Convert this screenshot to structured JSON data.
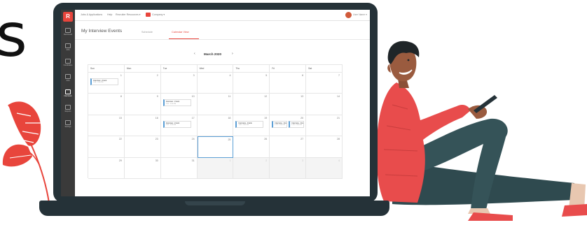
{
  "headline_letter": "s",
  "app": {
    "logo": "R",
    "sidebar": [
      {
        "label": "Dashboard",
        "icon": "dashboard-icon",
        "active": false
      },
      {
        "label": "Jobs",
        "icon": "briefcase-icon",
        "active": false
      },
      {
        "label": "Candidates",
        "icon": "candidates-icon",
        "active": false
      },
      {
        "label": "Jobs",
        "icon": "list-icon",
        "active": false
      },
      {
        "label": "Interviews",
        "icon": "interviews-icon",
        "active": true
      },
      {
        "label": "Reports",
        "icon": "reports-icon",
        "active": false
      },
      {
        "label": "Settings",
        "icon": "settings-icon",
        "active": false
      }
    ],
    "topbar": {
      "items": [
        "Jobs & Applications",
        "Help",
        "Recruiter Resources ▾",
        "Company ▾"
      ],
      "user": "User Name ▾"
    },
    "page_title": "My Interview Events",
    "tabs": [
      {
        "label": "Schedule",
        "active": false
      },
      {
        "label": "Calendar View",
        "active": true
      }
    ],
    "calendar": {
      "month": "March 2020",
      "prev": "‹",
      "next": "›",
      "weekdays": [
        "Sun",
        "Mon",
        "Tue",
        "Wed",
        "Thu",
        "Fri",
        "Sat"
      ],
      "weeks": [
        [
          {
            "day": "1",
            "event": {
              "title": "Interview - Frank",
              "time": "1:00 - 2:00 PM"
            }
          },
          {
            "day": "2"
          },
          {
            "day": "3"
          },
          {
            "day": "4"
          },
          {
            "day": "5"
          },
          {
            "day": "6"
          },
          {
            "day": "7"
          }
        ],
        [
          {
            "day": "8"
          },
          {
            "day": "9"
          },
          {
            "day": "10",
            "event": {
              "title": "Interview - Frank",
              "time": "1:00 - 2:00 PM"
            }
          },
          {
            "day": "11"
          },
          {
            "day": "12"
          },
          {
            "day": "13"
          },
          {
            "day": "14"
          }
        ],
        [
          {
            "day": "15"
          },
          {
            "day": "16"
          },
          {
            "day": "17",
            "event": {
              "title": "Interview - Frank",
              "time": "1:00 - 2:00 PM"
            }
          },
          {
            "day": "18"
          },
          {
            "day": "19",
            "event": {
              "title": "Interview - Frank",
              "time": "1:00 - 2:00 PM"
            }
          },
          {
            "day": "20",
            "event": {
              "title": "Interview - Frank",
              "time": "1:00 - 2:00 PM"
            },
            "event2": {
              "title": "Interview - Frank",
              "time": "1:00 - 2:00 PM"
            }
          },
          {
            "day": "21"
          }
        ],
        [
          {
            "day": "22"
          },
          {
            "day": "23"
          },
          {
            "day": "24"
          },
          {
            "day": "25",
            "today": true
          },
          {
            "day": "26"
          },
          {
            "day": "27"
          },
          {
            "day": "28"
          }
        ],
        [
          {
            "day": "29"
          },
          {
            "day": "30"
          },
          {
            "day": "31"
          },
          {
            "day": "1",
            "muted": true
          },
          {
            "day": "2",
            "muted": true
          },
          {
            "day": "3",
            "muted": true
          },
          {
            "day": "4",
            "muted": true
          }
        ]
      ]
    }
  },
  "colors": {
    "accent": "#e8453c",
    "laptop": "#253238",
    "event_border": "#5c9fd6",
    "shirt": "#e84c4c",
    "pants": "#2f4a4f",
    "leaf": "#e8453c"
  }
}
